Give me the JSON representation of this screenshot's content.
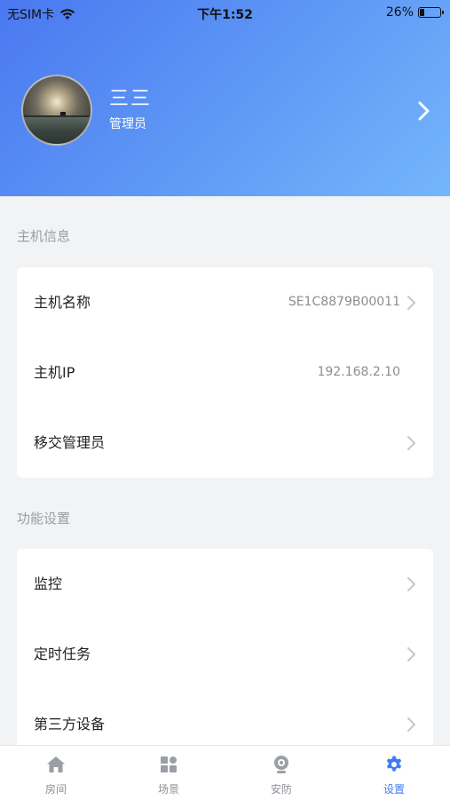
{
  "status_bar": {
    "carrier": "无SIM卡",
    "time": "下午1:52",
    "battery_percent": "26%",
    "battery_level": 0.26
  },
  "profile": {
    "name": "三三",
    "role": "管理员"
  },
  "sections": {
    "host_info": {
      "title": "主机信息",
      "rows": [
        {
          "label": "主机名称",
          "value": "SE1C8879B00011"
        },
        {
          "label": "主机IP",
          "value": "192.168.2.10"
        },
        {
          "label": "移交管理员",
          "value": ""
        }
      ]
    },
    "function_settings": {
      "title": "功能设置",
      "rows": [
        {
          "label": "监控"
        },
        {
          "label": "定时任务"
        },
        {
          "label": "第三方设备"
        }
      ]
    }
  },
  "tabbar": {
    "tabs": [
      {
        "label": "房间",
        "icon": "home-icon"
      },
      {
        "label": "场景",
        "icon": "grid-icon"
      },
      {
        "label": "安防",
        "icon": "camera-icon"
      },
      {
        "label": "设置",
        "icon": "gear-icon"
      }
    ],
    "active_index": 3
  },
  "colors": {
    "accent": "#3d7cf0",
    "header_start": "#4a78f0",
    "header_end": "#74b6fb"
  }
}
